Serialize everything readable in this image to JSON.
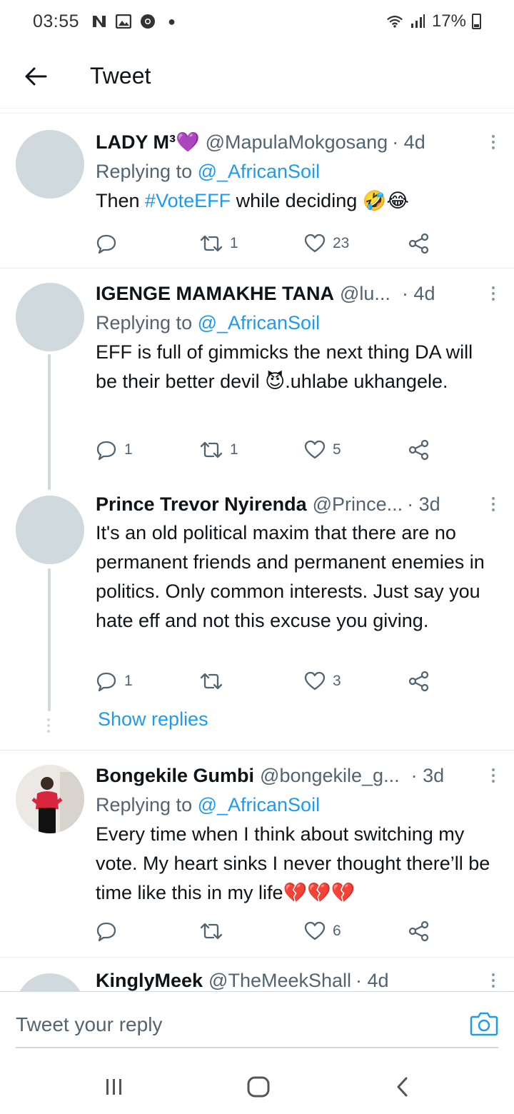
{
  "status_bar": {
    "time": "03:55",
    "battery": "17%",
    "icons": [
      "n-notification-icon",
      "image-icon",
      "chrome-icon",
      "dot-icon",
      "wifi-icon",
      "signal-icon",
      "battery-icon"
    ]
  },
  "header": {
    "title": "Tweet"
  },
  "tweets": [
    {
      "name": "LADY M³💜",
      "handle": "@MapulaMokgosang",
      "time": "· 4d",
      "replying_label": "Replying to ",
      "replying_handle": "@_AfricanSoil",
      "text_before": "Then ",
      "hashtag": "#VoteEFF",
      "text_after": " while deciding 🤣😂",
      "replies": "",
      "retweets": "1",
      "likes": "23"
    },
    {
      "name": "IGENGE MAMAKHE TANA",
      "handle": "@lu...",
      "time": "· 4d",
      "replying_label": "Replying to ",
      "replying_handle": "@_AfricanSoil",
      "text": "EFF is full of gimmicks the next thing DA will be their better devil 😈.uhlabe ukhangele.",
      "replies": "1",
      "retweets": "1",
      "likes": "5"
    },
    {
      "name": "Prince Trevor Nyirenda",
      "handle": "@Prince...",
      "time": "· 3d",
      "text": "It's an old political maxim that there are no permanent friends and permanent enemies in politics. Only common interests. Just say you hate eff and not this excuse you giving.",
      "replies": "1",
      "retweets": "",
      "likes": "3",
      "show_replies": "Show replies"
    },
    {
      "name": "Bongekile Gumbi",
      "handle": "@bongekile_g...",
      "time": "· 3d",
      "replying_label": "Replying to ",
      "replying_handle": "@_AfricanSoil",
      "text": "Every time when I think about switching my vote. My heart sinks I never thought there’ll be time like this in my life💔💔💔",
      "replies": "",
      "retweets": "",
      "likes": "6"
    },
    {
      "name": "KinglyMeek",
      "handle": "@TheMeekShall",
      "time": "· 4d"
    }
  ],
  "reply_bar": {
    "placeholder": "Tweet your reply"
  },
  "colors": {
    "accent": "#1d9bf0",
    "secondary_text": "#536471",
    "avatar_placeholder": "#cfd9de"
  }
}
